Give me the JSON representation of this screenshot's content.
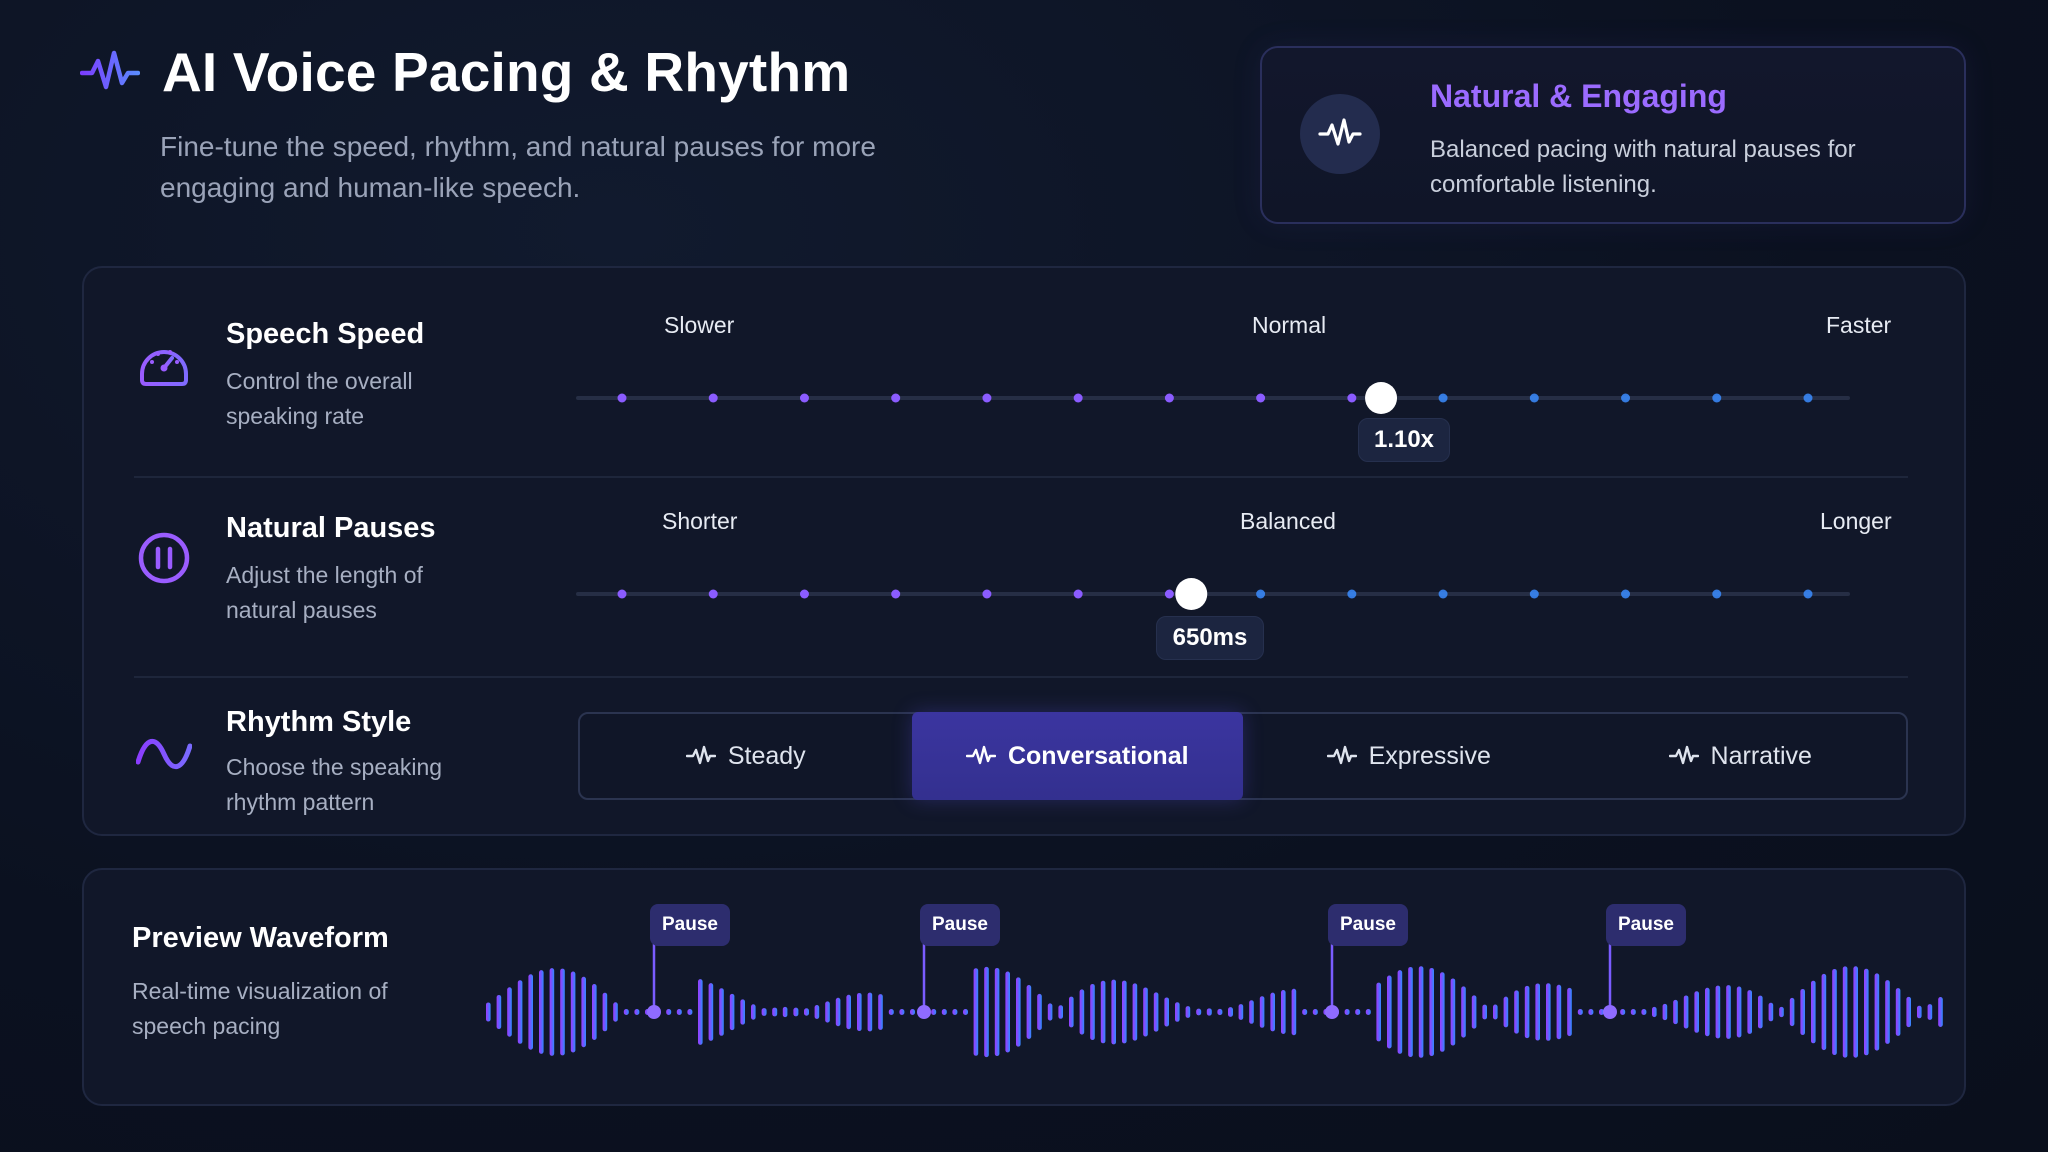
{
  "header": {
    "title": "AI Voice Pacing & Rhythm",
    "subtitle": "Fine-tune the speed, rhythm, and natural pauses for more engaging and human-like speech.",
    "icon": "waveform-pulse-icon"
  },
  "info_card": {
    "title": "Natural & Engaging",
    "text": "Balanced pacing with natural pauses for comfortable listening.",
    "icon": "waveform-pulse-icon"
  },
  "speech_speed": {
    "title": "Speech Speed",
    "description": "Control the overall speaking rate",
    "icon": "speedometer-icon",
    "label_min": "Slower",
    "label_mid": "Normal",
    "label_max": "Faster",
    "value_label": "1.10x",
    "position_fraction": 0.64
  },
  "natural_pauses": {
    "title": "Natural Pauses",
    "description": "Adjust the length of natural pauses",
    "icon": "pause-circle-icon",
    "label_min": "Shorter",
    "label_mid": "Balanced",
    "label_max": "Longer",
    "value_label": "650ms",
    "position_fraction": 0.48
  },
  "rhythm_style": {
    "title": "Rhythm Style",
    "description": "Choose the speaking rhythm pattern",
    "icon": "sine-wave-icon",
    "options": [
      "Steady",
      "Conversational",
      "Expressive",
      "Narrative"
    ],
    "selected": "Conversational"
  },
  "preview": {
    "title": "Preview Waveform",
    "description": "Real-time visualization of speech pacing",
    "pause_label": "Pause",
    "pause_count": 4
  },
  "colors": {
    "accent_purple": "#8b3dff",
    "accent_blue": "#3b8cff",
    "active_segment": "#3b35a0",
    "background": "#0b1120"
  }
}
